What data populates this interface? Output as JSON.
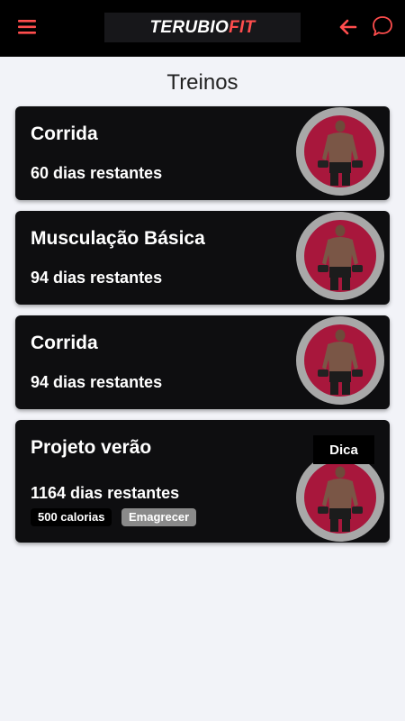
{
  "app": {
    "logo_part1": "TERUBIO",
    "logo_part2": "FIT",
    "brand_color": "#ff4d4d"
  },
  "header": {
    "menu_icon": "hamburger-menu-icon",
    "back_icon": "arrow-left-icon",
    "chat_icon": "chat-bubble-icon"
  },
  "page": {
    "title": "Treinos"
  },
  "workouts": [
    {
      "title": "Corrida",
      "days": "60 dias restantes"
    },
    {
      "title": "Musculação Básica",
      "days": "94 dias restantes"
    },
    {
      "title": "Corrida",
      "days": "94 dias restantes"
    },
    {
      "title": "Projeto verão",
      "days": "1164 dias restantes",
      "tags": [
        "500 calorias",
        "Emagrecer"
      ],
      "tip_label": "Dica"
    }
  ]
}
